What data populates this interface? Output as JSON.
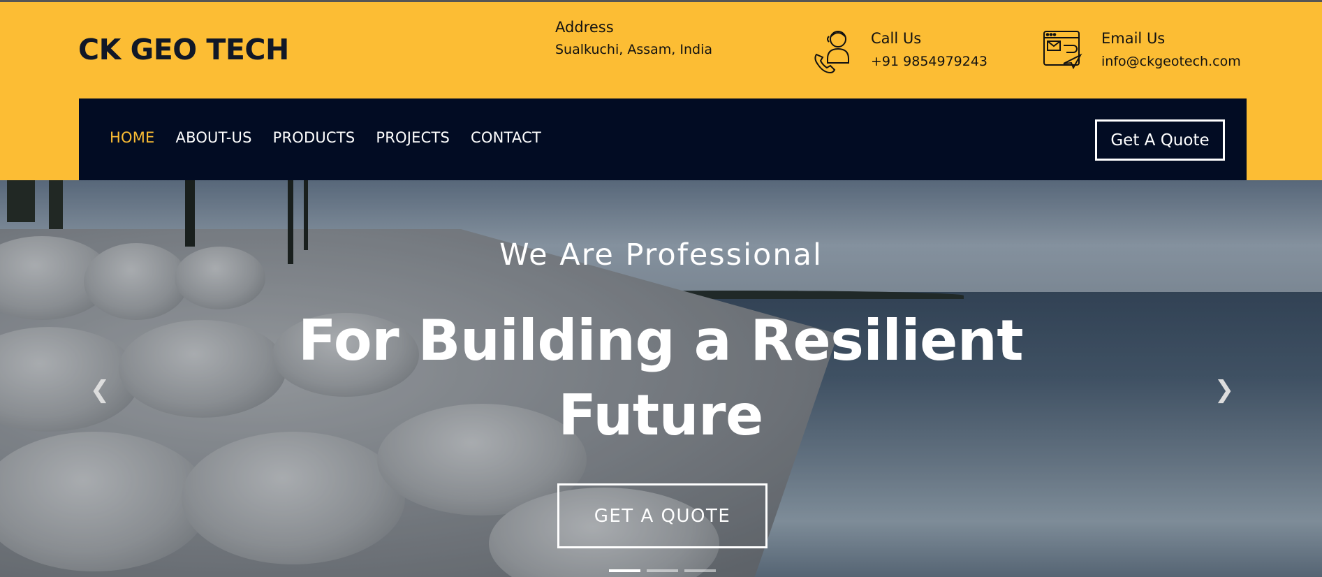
{
  "brand": {
    "name": "CK GEO TECH"
  },
  "contact": {
    "address": {
      "title": "Address",
      "value": "Sualkuchi, Assam, India"
    },
    "call": {
      "title": "Call Us",
      "value": "+91 9854979243",
      "icon": "support-phone-icon"
    },
    "email": {
      "title": "Email Us",
      "value": "info@ckgeotech.com",
      "icon": "email-send-icon"
    }
  },
  "nav": {
    "items": [
      {
        "label": "HOME",
        "active": true
      },
      {
        "label": "ABOUT-US",
        "active": false
      },
      {
        "label": "PRODUCTS",
        "active": false
      },
      {
        "label": "PROJECTS",
        "active": false
      },
      {
        "label": "CONTACT",
        "active": false
      }
    ],
    "cta_label": "Get A Quote"
  },
  "hero": {
    "subtitle": "We Are Professional",
    "title": "For Building a Resilient Future",
    "button_label": "GET A QUOTE",
    "prev_icon": "chevron-left-icon",
    "next_icon": "chevron-right-icon",
    "slides_total": 3,
    "active_slide": 1
  },
  "colors": {
    "accent": "#fbbd34",
    "nav_background": "#020c23",
    "text_dark": "#111827",
    "white": "#ffffff"
  }
}
